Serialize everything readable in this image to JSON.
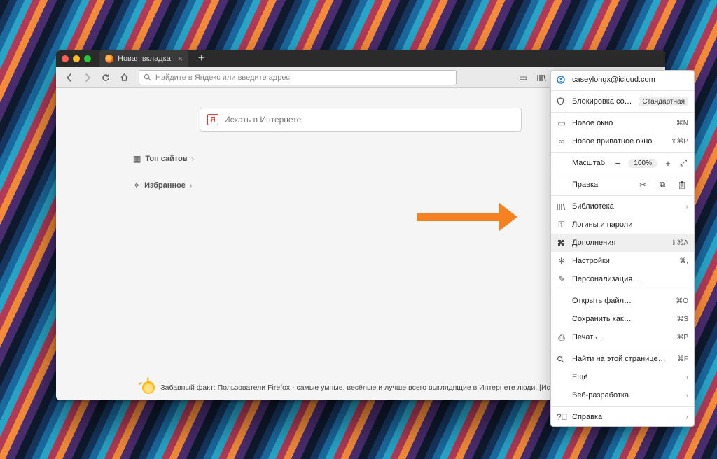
{
  "tab": {
    "title": "Новая вкладка"
  },
  "urlbar": {
    "placeholder": "Найдите в Яндекс или введите адрес"
  },
  "search": {
    "placeholder": "Искать в Интернете",
    "logo": "Я"
  },
  "sections": {
    "top_sites": "Топ сайтов",
    "favorites": "Избранное"
  },
  "fact": {
    "text": "Забавный факт: Пользователи Firefox - самые умные, весёлые и лучше всего выглядящие в Интернете люди. [Источник?]"
  },
  "menu": {
    "account": "caseylongx@icloud.com",
    "content_block": "Блокировка содержимого",
    "content_block_mode": "Стандартная",
    "new_window": "Новое окно",
    "new_window_sc": "⌘N",
    "new_private": "Новое приватное окно",
    "new_private_sc": "⇧⌘P",
    "zoom_label": "Масштаб",
    "zoom_value": "100%",
    "edit_label": "Правка",
    "library": "Библиотека",
    "logins": "Логины и пароли",
    "addons": "Дополнения",
    "addons_sc": "⇧⌘A",
    "settings": "Настройки",
    "settings_sc": "⌘,",
    "customize": "Персонализация…",
    "open_file": "Открыть файл…",
    "open_file_sc": "⌘O",
    "save_as": "Сохранить как…",
    "save_as_sc": "⌘S",
    "print": "Печать…",
    "print_sc": "⌘P",
    "find": "Найти на этой странице…",
    "find_sc": "⌘F",
    "more": "Ещё",
    "webdev": "Веб-разработка",
    "help": "Справка"
  }
}
